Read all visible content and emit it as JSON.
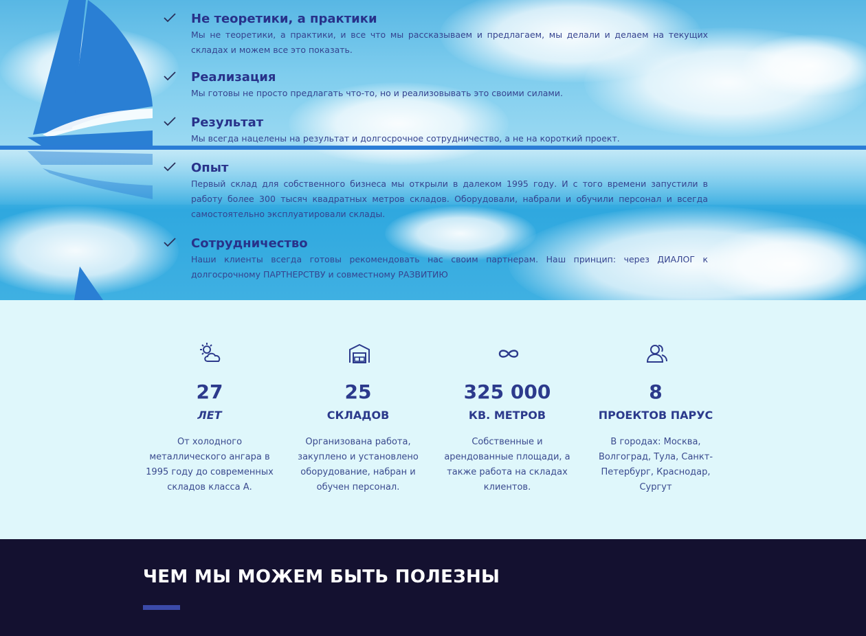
{
  "features": [
    {
      "title": "Не теоретики, а практики",
      "text": "Мы не теоретики, а практики, и все что мы рассказываем и предлагаем, мы делали и делаем на текущих складах и можем все это показать."
    },
    {
      "title": "Реализация",
      "text": "Мы готовы не просто предлагать что-то, но и реализовывать это своими силами."
    },
    {
      "title": "Результат",
      "text": "Мы всегда нацелены на результат и долгосрочное сотрудничество, а не на короткий проект."
    },
    {
      "title": "Опыт",
      "text": "Первый склад для собственного бизнеса мы открыли в далеком 1995 году. И с того времени запустили в работу более 300 тысяч квадратных метров складов. Оборудовали, набрали и обучили персонал и всегда самостоятельно эксплуатировали склады."
    },
    {
      "title": "Сотрудничество",
      "text": "Наши клиенты всегда готовы рекомендовать нас своим партнерам. Наш принцип: через ДИАЛОГ к долгосрочному ПАРТНЕРСТВУ и совместному РАЗВИТИЮ"
    }
  ],
  "stats": [
    {
      "icon": "weather-icon",
      "number": "27",
      "unit": "ЛЕТ",
      "desc": "От холодного металлического ангара в 1995 году до современных складов класса А."
    },
    {
      "icon": "warehouse-icon",
      "number": "25",
      "unit": "СКЛАДОВ",
      "desc": "Организована работа, закуплено и установлено оборудование, набран и обучен персонал."
    },
    {
      "icon": "infinity-icon",
      "number": "325 000",
      "unit": "КВ. МЕТРОВ",
      "desc": "Собственные и арендованные площади, а также работа на складах клиентов."
    },
    {
      "icon": "users-icon",
      "number": "8",
      "unit": "ПРОЕКТОВ ПАРУС",
      "desc": "В городах: Москва, Волгоград, Тула, Санкт-Петербург, Краснодар, Сургут"
    }
  ],
  "section": {
    "title": "ЧЕМ МЫ МОЖЕМ БЫТЬ ПОЛЕЗНЫ"
  },
  "colors": {
    "accent": "#2c3a8c",
    "dark": "#141130",
    "light_bg": "#dff7fb",
    "sail": "#2a7fd4"
  }
}
